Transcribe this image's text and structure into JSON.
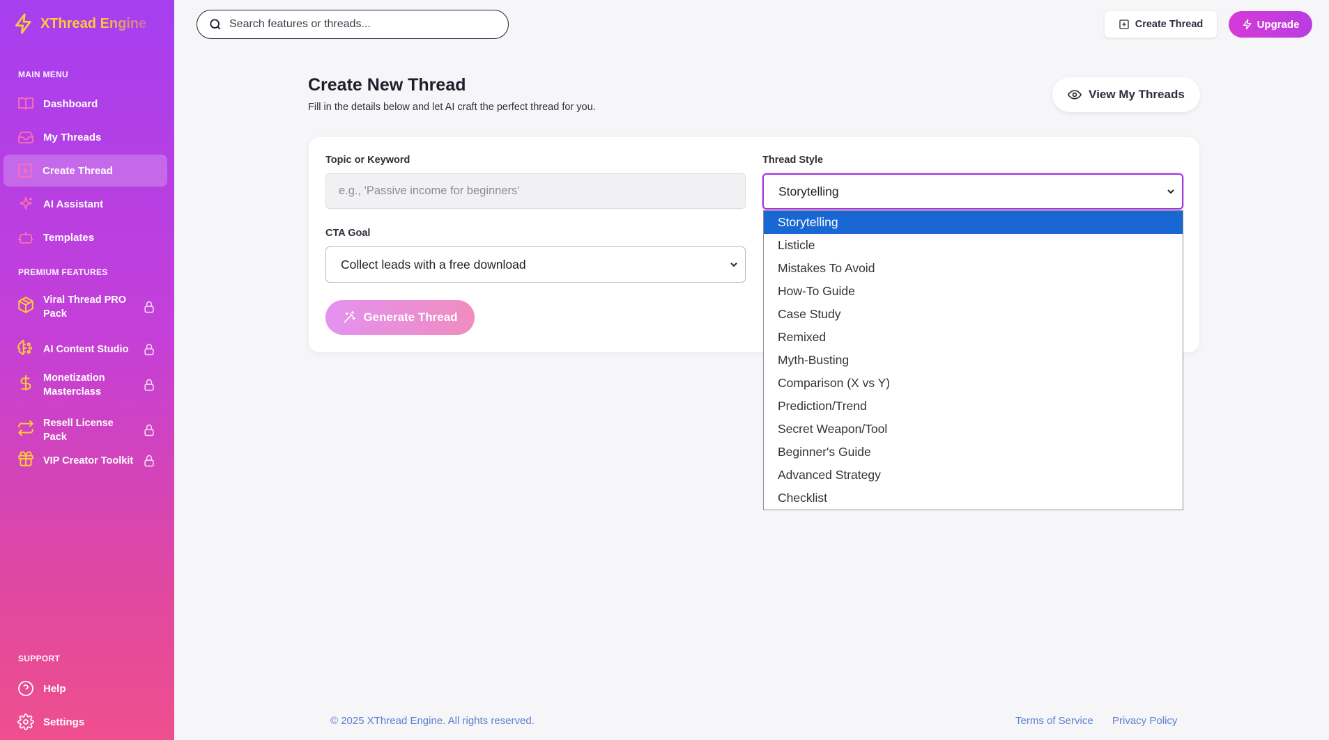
{
  "brand": {
    "name": "XThread Engine"
  },
  "sidebar": {
    "main_menu_label": "MAIN MENU",
    "items": [
      {
        "label": "Dashboard",
        "icon": "book-open-icon"
      },
      {
        "label": "My Threads",
        "icon": "inbox-icon"
      },
      {
        "label": "Create Thread",
        "icon": "plus-square-icon",
        "active": true
      },
      {
        "label": "AI Assistant",
        "icon": "sparkles-icon"
      },
      {
        "label": "Templates",
        "icon": "robot-icon"
      }
    ],
    "premium_label": "PREMIUM FEATURES",
    "premium_items": [
      {
        "label": "Viral Thread PRO Pack",
        "icon": "box-icon",
        "locked": true
      },
      {
        "label": "AI Content Studio",
        "icon": "brain-icon",
        "locked": true
      },
      {
        "label": "Monetization Masterclass",
        "icon": "dollar-icon",
        "locked": true
      },
      {
        "label": "Resell License Pack",
        "icon": "repeat-icon",
        "locked": true
      },
      {
        "label": "VIP Creator Toolkit",
        "icon": "gift-icon",
        "locked": true
      }
    ],
    "support_label": "SUPPORT",
    "support_items": [
      {
        "label": "Help",
        "icon": "help-circle-icon"
      },
      {
        "label": "Settings",
        "icon": "gear-icon"
      }
    ]
  },
  "topbar": {
    "search_placeholder": "Search features or threads...",
    "create_label": "Create Thread",
    "upgrade_label": "Upgrade"
  },
  "header": {
    "title": "Create New Thread",
    "subtitle": "Fill in the details below and let AI craft the perfect thread for you.",
    "view_threads_label": "View My Threads"
  },
  "form": {
    "topic_label": "Topic or Keyword",
    "topic_placeholder": "e.g., 'Passive income for beginners'",
    "style_label": "Thread Style",
    "style_value": "Storytelling",
    "cta_label": "CTA Goal",
    "cta_value": "Collect leads with a free download",
    "generate_label": "Generate Thread"
  },
  "style_options": [
    "Storytelling",
    "Listicle",
    "Mistakes To Avoid",
    "How-To Guide",
    "Case Study",
    "Remixed",
    "Myth-Busting",
    "Comparison (X vs Y)",
    "Prediction/Trend",
    "Secret Weapon/Tool",
    "Beginner's Guide",
    "Advanced Strategy",
    "Checklist"
  ],
  "footer": {
    "copyright": "© 2025 XThread Engine. All rights reserved.",
    "terms": "Terms of Service",
    "privacy": "Privacy Policy"
  },
  "colors": {
    "accent": "#a63ff0",
    "brand_yellow": "#ffcc33",
    "upgrade": "#d53ad8",
    "selected_option": "#1967d2",
    "link": "#5b7fcf"
  }
}
